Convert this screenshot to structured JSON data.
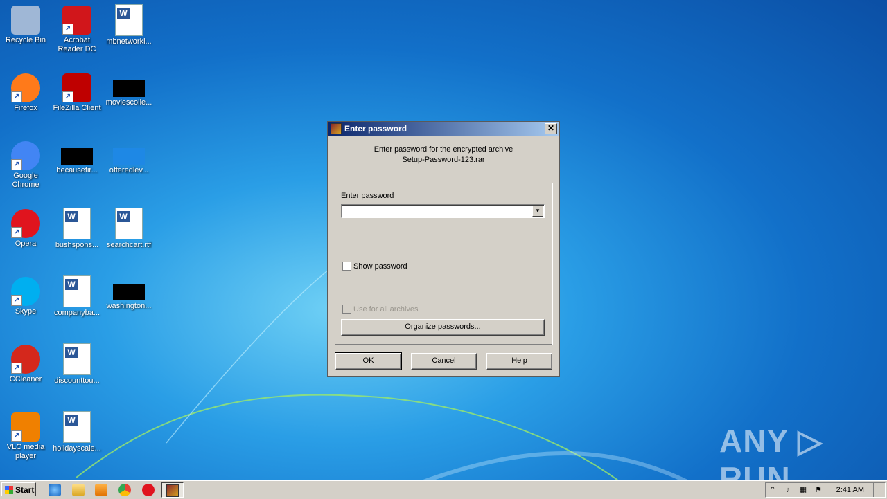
{
  "desktop": {
    "icons": [
      {
        "label": "Recycle Bin",
        "icon": "recycle-bin-icon",
        "color": "#9fb7d6"
      },
      {
        "label": "Acrobat Reader DC",
        "icon": "acrobat-reader-icon",
        "color": "#d1161b"
      },
      {
        "label": "mbnetworki...",
        "icon": "word-document-icon",
        "color": "#2b5797"
      },
      {
        "label": "Firefox",
        "icon": "firefox-icon",
        "color": "#ff7a1a"
      },
      {
        "label": "FileZilla Client",
        "icon": "filezilla-icon",
        "color": "#bf0000"
      },
      {
        "label": "moviescolle...",
        "icon": "black-thumbnail-icon",
        "color": "#000000"
      },
      {
        "label": "Google Chrome",
        "icon": "chrome-icon",
        "color": "#4285f4"
      },
      {
        "label": "becausefir...",
        "icon": "black-thumbnail-icon",
        "color": "#000000"
      },
      {
        "label": "offeredlev...",
        "icon": "blue-thumbnail-icon",
        "color": "#1e88e5"
      },
      {
        "label": "Opera",
        "icon": "opera-icon",
        "color": "#e0141e"
      },
      {
        "label": "bushspons...",
        "icon": "word-document-icon",
        "color": "#2b5797"
      },
      {
        "label": "searchcart.rtf",
        "icon": "word-document-icon",
        "color": "#2b5797"
      },
      {
        "label": "Skype",
        "icon": "skype-icon",
        "color": "#00aff0"
      },
      {
        "label": "companyba...",
        "icon": "word-document-icon",
        "color": "#2b5797"
      },
      {
        "label": "washington...",
        "icon": "black-thumbnail-icon",
        "color": "#000000"
      },
      {
        "label": "CCleaner",
        "icon": "ccleaner-icon",
        "color": "#d4281c"
      },
      {
        "label": "discounttou...",
        "icon": "word-document-icon",
        "color": "#2b5797"
      },
      {
        "label": "VLC media player",
        "icon": "vlc-icon",
        "color": "#f08000"
      },
      {
        "label": "holidayscale...",
        "icon": "word-document-icon",
        "color": "#2b5797"
      }
    ]
  },
  "dialog": {
    "title": "Enter password",
    "message_line1": "Enter password for the encrypted archive",
    "message_line2": "Setup-Password-123.rar",
    "password_label": "Enter password",
    "password_value": "",
    "show_password_label": "Show password",
    "use_for_all_label": "Use for all archives",
    "organize_label": "Organize passwords...",
    "ok_label": "OK",
    "cancel_label": "Cancel",
    "help_label": "Help",
    "close_glyph": "✕"
  },
  "taskbar": {
    "start_label": "Start",
    "clock": "2:41 AM",
    "pinned": [
      "internet-explorer-icon",
      "explorer-folder-icon",
      "media-player-icon",
      "chrome-icon",
      "opera-icon"
    ]
  },
  "watermark": "ANY ▷ RUN"
}
